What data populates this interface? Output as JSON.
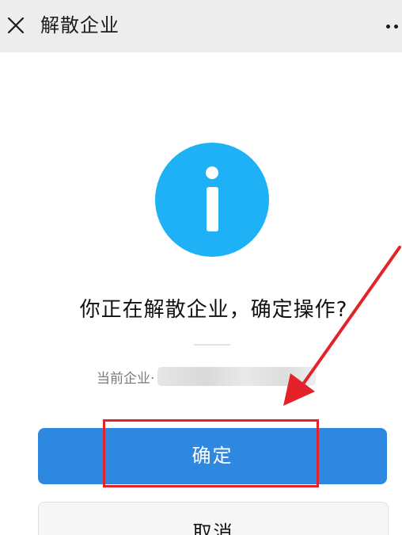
{
  "titlebar": {
    "title": "解散企业",
    "close_icon": "close-icon",
    "more_icon": "more-icon"
  },
  "dialog": {
    "icon": "info-icon",
    "icon_color": "#1fb1f5",
    "question": "你正在解散企业，确定操作?",
    "company_label": "当前企业·"
  },
  "actions": {
    "confirm_label": "确定",
    "cancel_label": "取消",
    "confirm_color": "#2f88e0"
  },
  "annotation": {
    "color": "#e3222a"
  }
}
